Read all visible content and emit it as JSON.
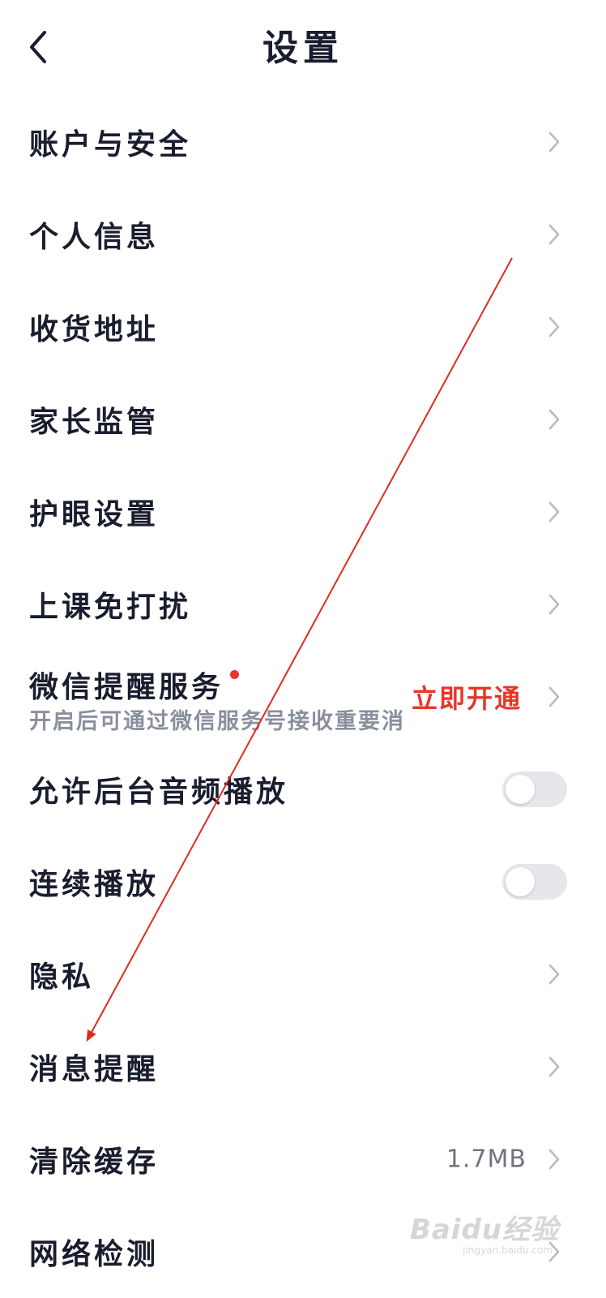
{
  "header": {
    "title": "设置",
    "back_icon": "chevron-left-icon"
  },
  "rows": [
    {
      "label": "账户与安全"
    },
    {
      "label": "个人信息"
    },
    {
      "label": "收货地址"
    },
    {
      "label": "家长监管"
    },
    {
      "label": "护眼设置"
    },
    {
      "label": "上课免打扰"
    },
    {
      "label": "微信提醒服务",
      "desc": "开启后可通过微信服务号接收重要消息提醒",
      "action": "立即开通",
      "badge_color": "#e8352b"
    },
    {
      "label": "允许后台音频播放",
      "toggle_on": false
    },
    {
      "label": "连续播放",
      "toggle_on": false
    },
    {
      "label": "隐私"
    },
    {
      "label": "消息提醒"
    },
    {
      "label": "清除缓存",
      "value": "1.7MB"
    },
    {
      "label": "网络检测"
    }
  ],
  "watermark": {
    "text": "Baidu经验",
    "sub": "jingyan.baidu.com"
  },
  "colors": {
    "accent": "#e8352b",
    "text": "#1a1d2e",
    "secondary": "#8a8f9c",
    "chevron": "#b8bbc3",
    "toggle_off": "#e6e7ea"
  }
}
